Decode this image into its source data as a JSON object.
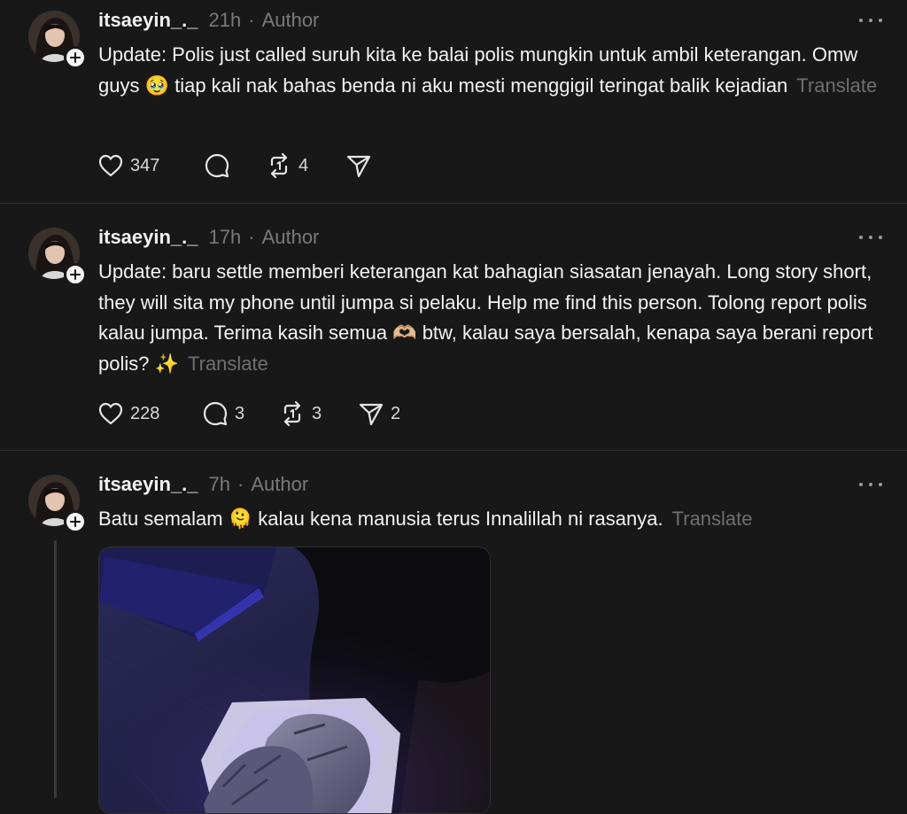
{
  "posts": [
    {
      "username": "itsaeyin_._",
      "time": "21h",
      "separator": "·",
      "author": "Author",
      "text": "Update: Polis just called suruh kita ke balai polis mungkin untuk ambil keterangan. Omw guys 🥹 tiap kali nak bahas benda ni aku mesti menggigil teringat balik kejadian",
      "translate": "Translate",
      "likes": "347",
      "replies": "",
      "reposts": "4",
      "shares": ""
    },
    {
      "username": "itsaeyin_._",
      "time": "17h",
      "separator": "·",
      "author": "Author",
      "text": "Update: baru settle memberi keterangan kat bahagian siasatan jenayah. Long story short, they will sita my phone until jumpa si pelaku. Help me find this person. Tolong report polis kalau jumpa. Terima kasih semua 🫶🏼 btw, kalau saya bersalah, kenapa saya berani report polis? ✨",
      "translate": "Translate",
      "likes": "228",
      "replies": "3",
      "reposts": "3",
      "shares": "2"
    },
    {
      "username": "itsaeyin_._",
      "time": "7h",
      "separator": "·",
      "author": "Author",
      "text": "Batu semalam 🫠 kalau kena manusia terus Innalillah ni rasanya.",
      "translate": "Translate"
    }
  ],
  "icons": {
    "like": "heart-icon",
    "reply": "comment-icon",
    "repost": "repost-icon",
    "share": "send-icon",
    "more": "more-options-icon",
    "follow": "plus-icon"
  },
  "colors": {
    "background": "#181818",
    "text": "#f3f3f3",
    "muted": "#7a7a7a",
    "divider": "#2d2d2d"
  }
}
